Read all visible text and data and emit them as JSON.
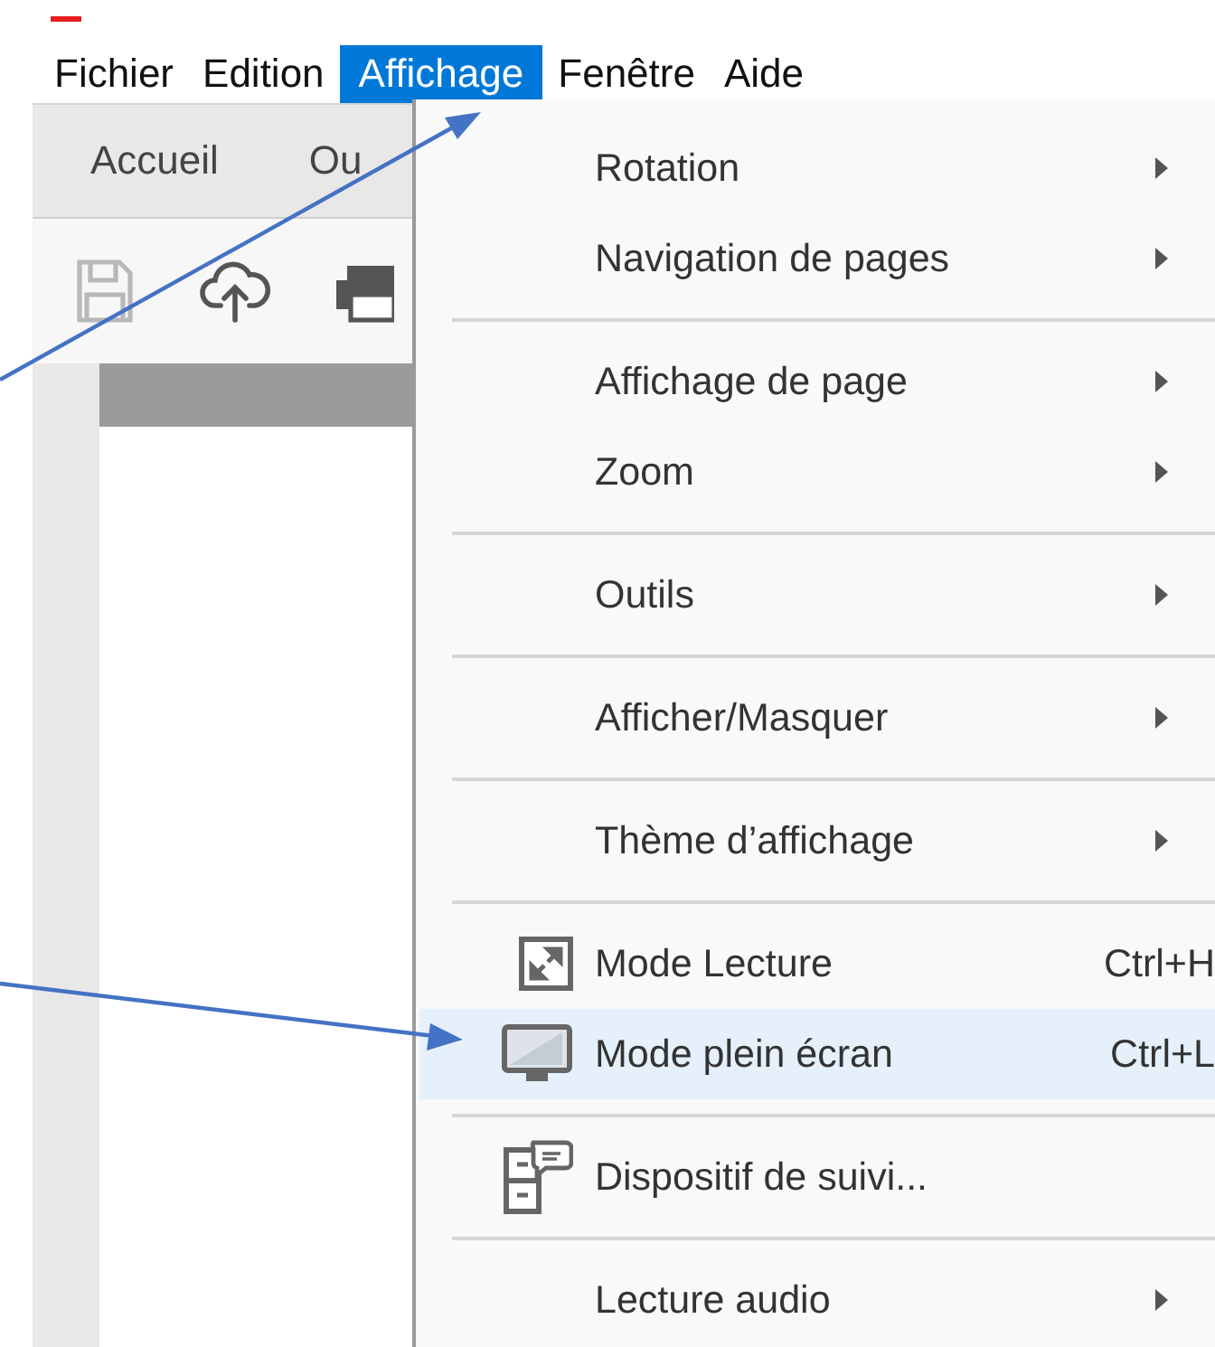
{
  "menubar": [
    {
      "label": "Fichier",
      "selected": false
    },
    {
      "label": "Edition",
      "selected": false
    },
    {
      "label": "Affichage",
      "selected": true
    },
    {
      "label": "Fenêtre",
      "selected": false
    },
    {
      "label": "Aide",
      "selected": false
    }
  ],
  "tabs": [
    {
      "label": "Accueil"
    },
    {
      "label": "Ou"
    }
  ],
  "menu": {
    "items": [
      {
        "kind": "submenu",
        "label": "Rotation",
        "highlighted": false
      },
      {
        "kind": "submenu",
        "label": "Navigation de pages",
        "highlighted": false
      },
      {
        "kind": "separator"
      },
      {
        "kind": "submenu",
        "label": "Affichage de page",
        "highlighted": false
      },
      {
        "kind": "submenu",
        "label": "Zoom",
        "highlighted": false
      },
      {
        "kind": "separator"
      },
      {
        "kind": "submenu",
        "label": "Outils",
        "highlighted": false
      },
      {
        "kind": "separator"
      },
      {
        "kind": "submenu",
        "label": "Afficher/Masquer",
        "highlighted": false
      },
      {
        "kind": "separator"
      },
      {
        "kind": "submenu",
        "label": "Thème d’affichage",
        "highlighted": false
      },
      {
        "kind": "separator"
      },
      {
        "kind": "command",
        "label": "Mode Lecture",
        "shortcut": "Ctrl+H",
        "highlighted": false
      },
      {
        "kind": "command",
        "label": "Mode plein écran",
        "shortcut": "Ctrl+L",
        "highlighted": true
      },
      {
        "kind": "separator"
      },
      {
        "kind": "command",
        "label": "Dispositif de suivi...",
        "highlighted": false
      },
      {
        "kind": "separator"
      },
      {
        "kind": "submenu",
        "label": "Lecture audio",
        "highlighted": false
      }
    ]
  }
}
